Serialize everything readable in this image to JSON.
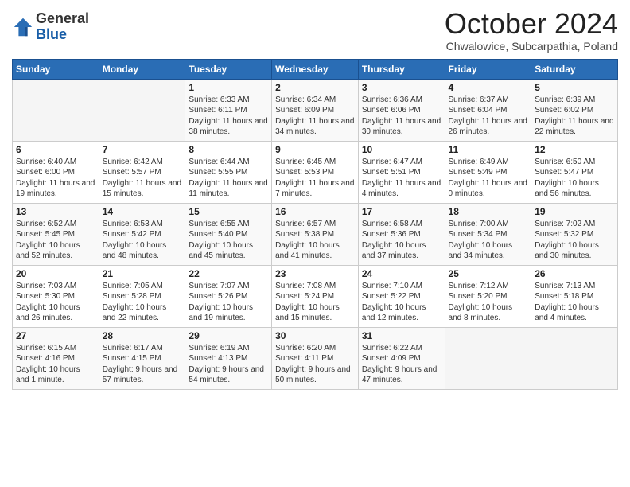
{
  "logo": {
    "general": "General",
    "blue": "Blue"
  },
  "title": "October 2024",
  "location": "Chwalowice, Subcarpathia, Poland",
  "days_of_week": [
    "Sunday",
    "Monday",
    "Tuesday",
    "Wednesday",
    "Thursday",
    "Friday",
    "Saturday"
  ],
  "weeks": [
    [
      {
        "day": "",
        "sunrise": "",
        "sunset": "",
        "daylight": ""
      },
      {
        "day": "",
        "sunrise": "",
        "sunset": "",
        "daylight": ""
      },
      {
        "day": "1",
        "sunrise": "Sunrise: 6:33 AM",
        "sunset": "Sunset: 6:11 PM",
        "daylight": "Daylight: 11 hours and 38 minutes."
      },
      {
        "day": "2",
        "sunrise": "Sunrise: 6:34 AM",
        "sunset": "Sunset: 6:09 PM",
        "daylight": "Daylight: 11 hours and 34 minutes."
      },
      {
        "day": "3",
        "sunrise": "Sunrise: 6:36 AM",
        "sunset": "Sunset: 6:06 PM",
        "daylight": "Daylight: 11 hours and 30 minutes."
      },
      {
        "day": "4",
        "sunrise": "Sunrise: 6:37 AM",
        "sunset": "Sunset: 6:04 PM",
        "daylight": "Daylight: 11 hours and 26 minutes."
      },
      {
        "day": "5",
        "sunrise": "Sunrise: 6:39 AM",
        "sunset": "Sunset: 6:02 PM",
        "daylight": "Daylight: 11 hours and 22 minutes."
      }
    ],
    [
      {
        "day": "6",
        "sunrise": "Sunrise: 6:40 AM",
        "sunset": "Sunset: 6:00 PM",
        "daylight": "Daylight: 11 hours and 19 minutes."
      },
      {
        "day": "7",
        "sunrise": "Sunrise: 6:42 AM",
        "sunset": "Sunset: 5:57 PM",
        "daylight": "Daylight: 11 hours and 15 minutes."
      },
      {
        "day": "8",
        "sunrise": "Sunrise: 6:44 AM",
        "sunset": "Sunset: 5:55 PM",
        "daylight": "Daylight: 11 hours and 11 minutes."
      },
      {
        "day": "9",
        "sunrise": "Sunrise: 6:45 AM",
        "sunset": "Sunset: 5:53 PM",
        "daylight": "Daylight: 11 hours and 7 minutes."
      },
      {
        "day": "10",
        "sunrise": "Sunrise: 6:47 AM",
        "sunset": "Sunset: 5:51 PM",
        "daylight": "Daylight: 11 hours and 4 minutes."
      },
      {
        "day": "11",
        "sunrise": "Sunrise: 6:49 AM",
        "sunset": "Sunset: 5:49 PM",
        "daylight": "Daylight: 11 hours and 0 minutes."
      },
      {
        "day": "12",
        "sunrise": "Sunrise: 6:50 AM",
        "sunset": "Sunset: 5:47 PM",
        "daylight": "Daylight: 10 hours and 56 minutes."
      }
    ],
    [
      {
        "day": "13",
        "sunrise": "Sunrise: 6:52 AM",
        "sunset": "Sunset: 5:45 PM",
        "daylight": "Daylight: 10 hours and 52 minutes."
      },
      {
        "day": "14",
        "sunrise": "Sunrise: 6:53 AM",
        "sunset": "Sunset: 5:42 PM",
        "daylight": "Daylight: 10 hours and 48 minutes."
      },
      {
        "day": "15",
        "sunrise": "Sunrise: 6:55 AM",
        "sunset": "Sunset: 5:40 PM",
        "daylight": "Daylight: 10 hours and 45 minutes."
      },
      {
        "day": "16",
        "sunrise": "Sunrise: 6:57 AM",
        "sunset": "Sunset: 5:38 PM",
        "daylight": "Daylight: 10 hours and 41 minutes."
      },
      {
        "day": "17",
        "sunrise": "Sunrise: 6:58 AM",
        "sunset": "Sunset: 5:36 PM",
        "daylight": "Daylight: 10 hours and 37 minutes."
      },
      {
        "day": "18",
        "sunrise": "Sunrise: 7:00 AM",
        "sunset": "Sunset: 5:34 PM",
        "daylight": "Daylight: 10 hours and 34 minutes."
      },
      {
        "day": "19",
        "sunrise": "Sunrise: 7:02 AM",
        "sunset": "Sunset: 5:32 PM",
        "daylight": "Daylight: 10 hours and 30 minutes."
      }
    ],
    [
      {
        "day": "20",
        "sunrise": "Sunrise: 7:03 AM",
        "sunset": "Sunset: 5:30 PM",
        "daylight": "Daylight: 10 hours and 26 minutes."
      },
      {
        "day": "21",
        "sunrise": "Sunrise: 7:05 AM",
        "sunset": "Sunset: 5:28 PM",
        "daylight": "Daylight: 10 hours and 22 minutes."
      },
      {
        "day": "22",
        "sunrise": "Sunrise: 7:07 AM",
        "sunset": "Sunset: 5:26 PM",
        "daylight": "Daylight: 10 hours and 19 minutes."
      },
      {
        "day": "23",
        "sunrise": "Sunrise: 7:08 AM",
        "sunset": "Sunset: 5:24 PM",
        "daylight": "Daylight: 10 hours and 15 minutes."
      },
      {
        "day": "24",
        "sunrise": "Sunrise: 7:10 AM",
        "sunset": "Sunset: 5:22 PM",
        "daylight": "Daylight: 10 hours and 12 minutes."
      },
      {
        "day": "25",
        "sunrise": "Sunrise: 7:12 AM",
        "sunset": "Sunset: 5:20 PM",
        "daylight": "Daylight: 10 hours and 8 minutes."
      },
      {
        "day": "26",
        "sunrise": "Sunrise: 7:13 AM",
        "sunset": "Sunset: 5:18 PM",
        "daylight": "Daylight: 10 hours and 4 minutes."
      }
    ],
    [
      {
        "day": "27",
        "sunrise": "Sunrise: 6:15 AM",
        "sunset": "Sunset: 4:16 PM",
        "daylight": "Daylight: 10 hours and 1 minute."
      },
      {
        "day": "28",
        "sunrise": "Sunrise: 6:17 AM",
        "sunset": "Sunset: 4:15 PM",
        "daylight": "Daylight: 9 hours and 57 minutes."
      },
      {
        "day": "29",
        "sunrise": "Sunrise: 6:19 AM",
        "sunset": "Sunset: 4:13 PM",
        "daylight": "Daylight: 9 hours and 54 minutes."
      },
      {
        "day": "30",
        "sunrise": "Sunrise: 6:20 AM",
        "sunset": "Sunset: 4:11 PM",
        "daylight": "Daylight: 9 hours and 50 minutes."
      },
      {
        "day": "31",
        "sunrise": "Sunrise: 6:22 AM",
        "sunset": "Sunset: 4:09 PM",
        "daylight": "Daylight: 9 hours and 47 minutes."
      },
      {
        "day": "",
        "sunrise": "",
        "sunset": "",
        "daylight": ""
      },
      {
        "day": "",
        "sunrise": "",
        "sunset": "",
        "daylight": ""
      }
    ]
  ]
}
